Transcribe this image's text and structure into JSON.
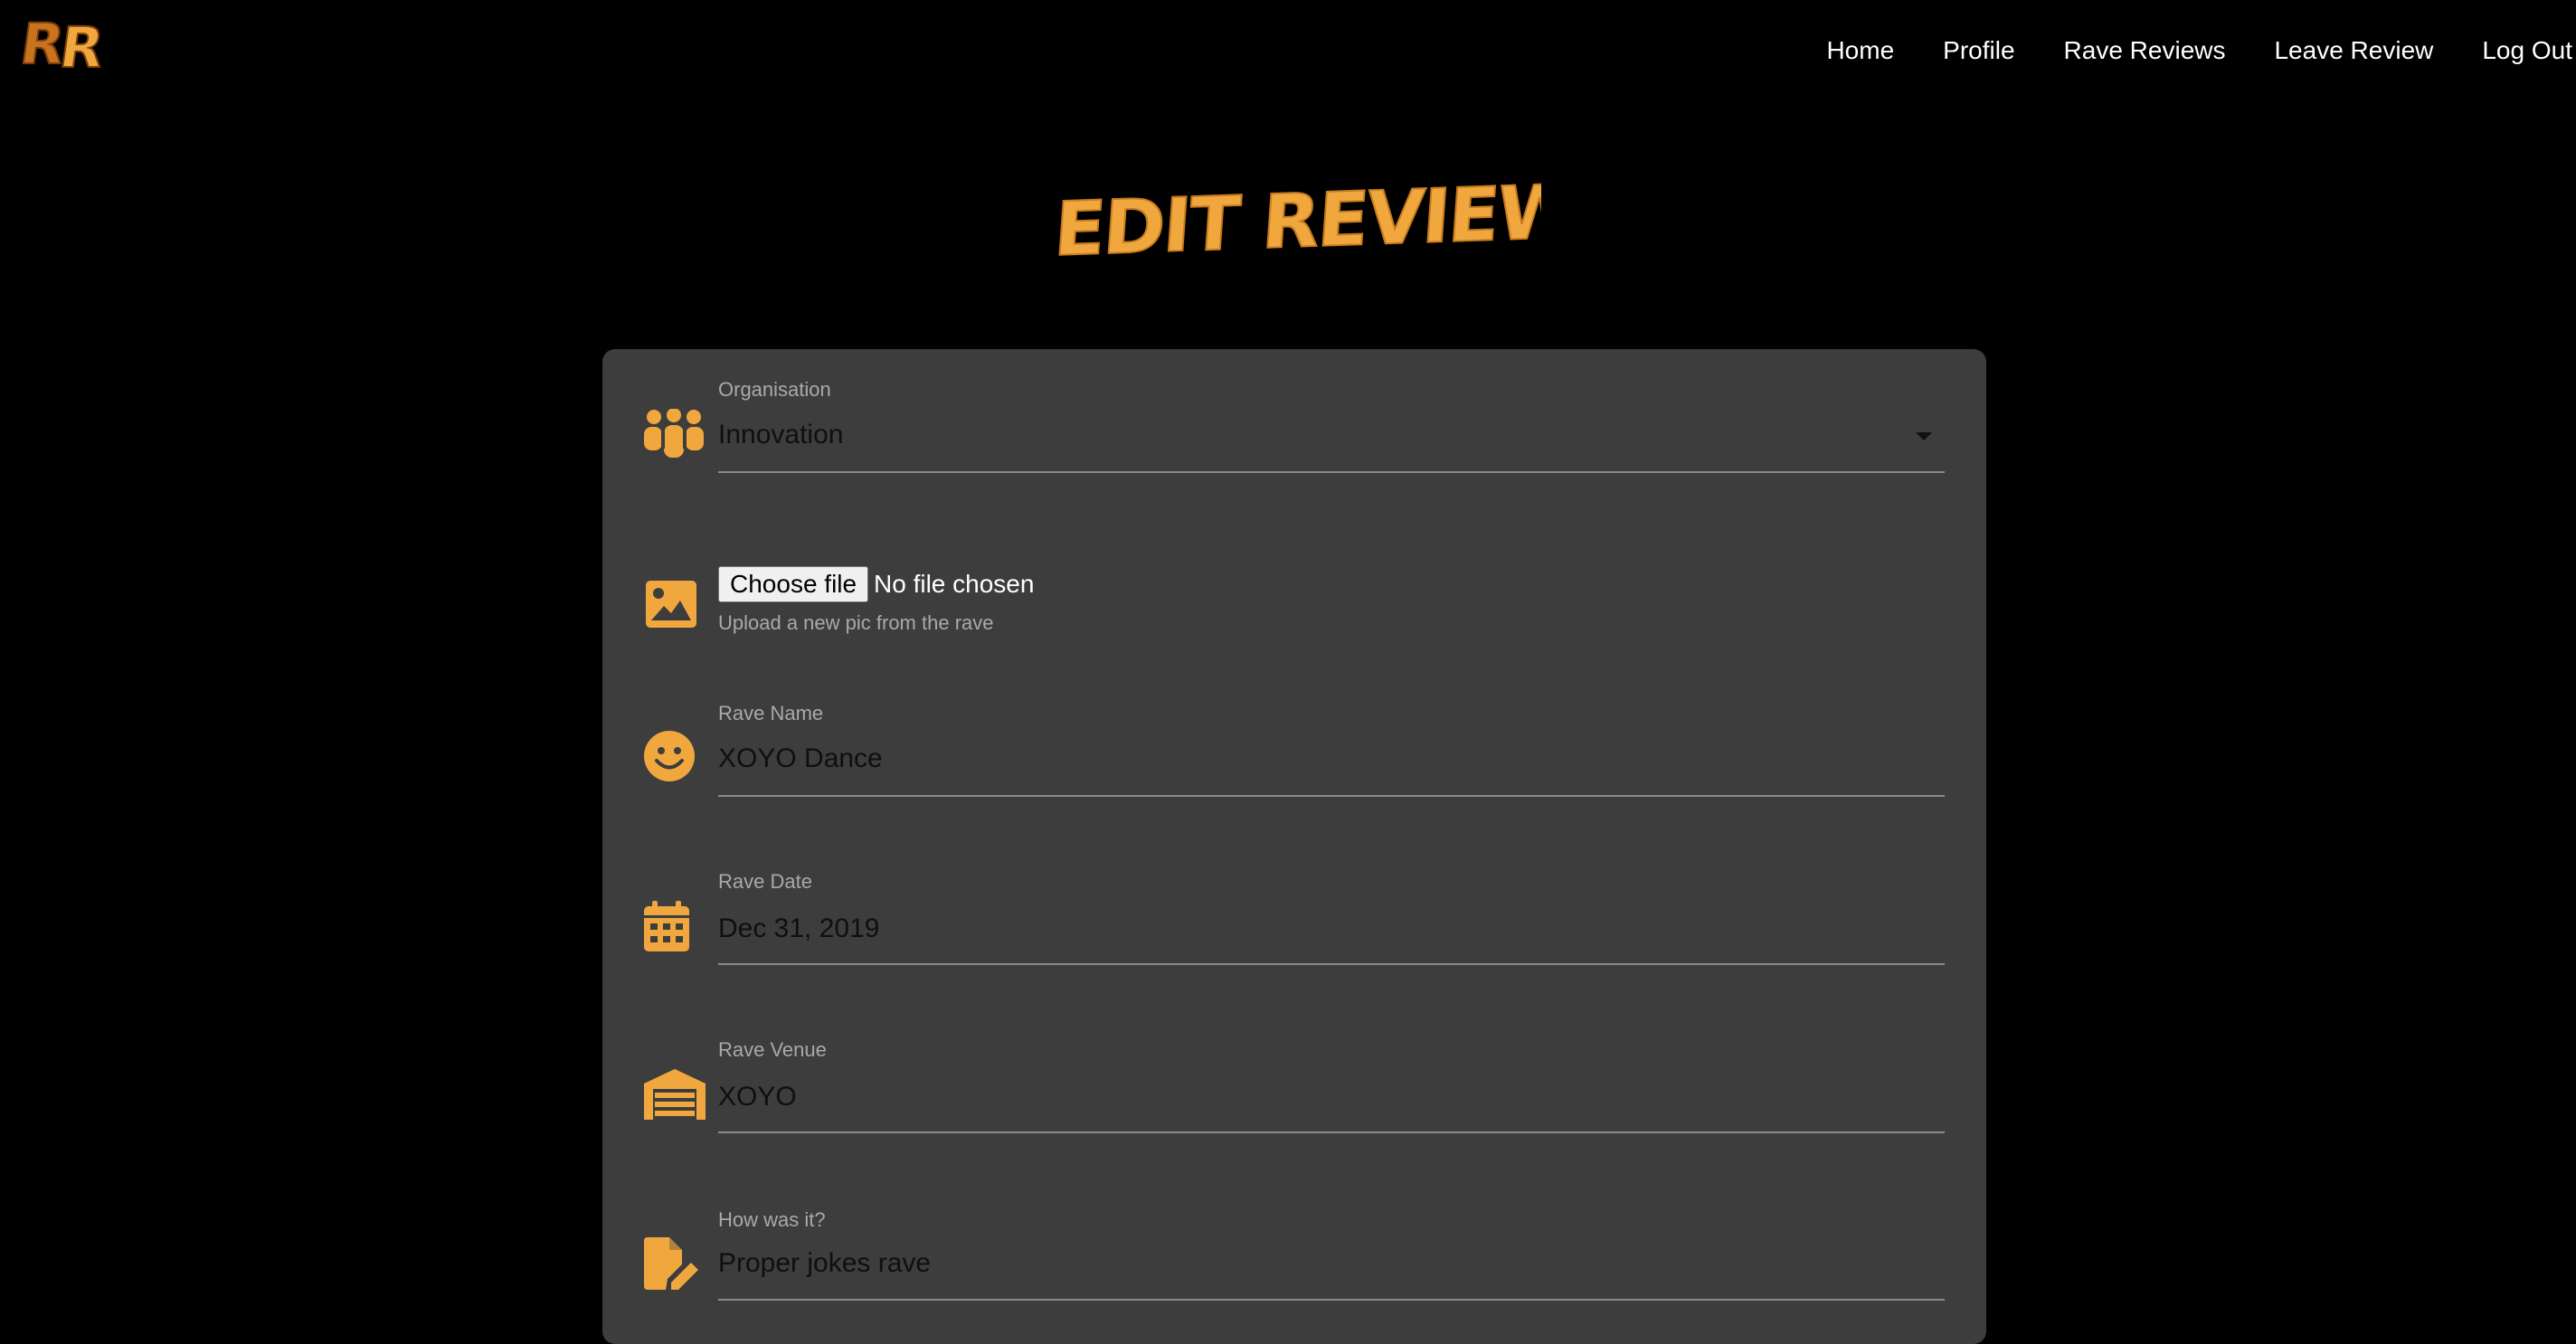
{
  "brand": {
    "logo_text": "RR",
    "accent_color": "#f0a83e"
  },
  "nav": {
    "items": [
      {
        "label": "Home"
      },
      {
        "label": "Profile"
      },
      {
        "label": "Rave Reviews"
      },
      {
        "label": "Leave Review"
      },
      {
        "label": "Log Out"
      }
    ]
  },
  "page": {
    "title": "EDIT REVIEW"
  },
  "form": {
    "organisation": {
      "label": "Organisation",
      "value": "Innovation",
      "icon": "group-icon"
    },
    "photo": {
      "button_label": "Choose file",
      "status": "No file chosen",
      "helper": "Upload a new pic from the rave",
      "icon": "image-icon"
    },
    "rave_name": {
      "label": "Rave Name",
      "value": "XOYO Dance",
      "icon": "smiley-icon"
    },
    "rave_date": {
      "label": "Rave Date",
      "value": "Dec 31, 2019",
      "icon": "calendar-icon"
    },
    "rave_venue": {
      "label": "Rave Venue",
      "value": "XOYO",
      "icon": "warehouse-icon"
    },
    "review": {
      "label": "How was it?",
      "value": "Proper jokes rave",
      "icon": "edit-document-icon"
    }
  }
}
